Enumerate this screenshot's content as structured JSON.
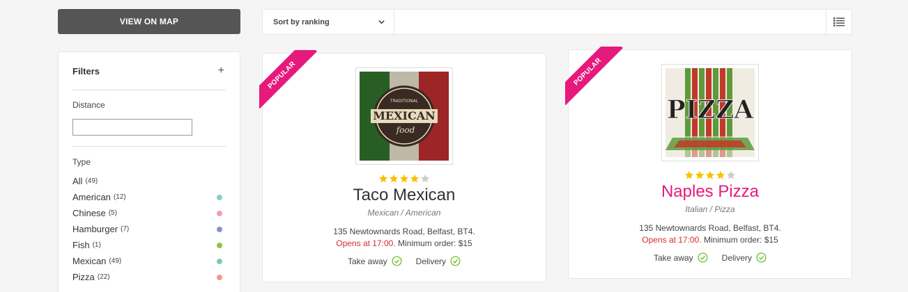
{
  "map_button": {
    "label": "VIEW ON MAP"
  },
  "toolbar": {
    "sort_label": "Sort by ranking",
    "sort_icon": "chevron-down-icon",
    "view_icon": "list-view-icon"
  },
  "filters": {
    "title": "Filters",
    "toggle_symbol": "+",
    "distance_label": "Distance",
    "distance_value": "",
    "type_label": "Type",
    "types": [
      {
        "label": "All",
        "count": "(49)",
        "color": ""
      },
      {
        "label": "American",
        "count": "(12)",
        "color": "#7fd1c9"
      },
      {
        "label": "Chinese",
        "count": "(5)",
        "color": "#f39ac0"
      },
      {
        "label": "Hamburger",
        "count": "(7)",
        "color": "#8a93c6"
      },
      {
        "label": "Fish",
        "count": "(1)",
        "color": "#8cc63f"
      },
      {
        "label": "Mexican",
        "count": "(49)",
        "color": "#7fcba8"
      },
      {
        "label": "Pizza",
        "count": "(22)",
        "color": "#ee9b86"
      }
    ]
  },
  "restaurants": [
    {
      "ribbon": "POPULAR",
      "name": "Taco Mexican",
      "rating": 4,
      "rating_max": 5,
      "cuisine": "Mexican / American",
      "address": "135 Newtownards Road, Belfast, BT4.",
      "opens": "Opens at 17:00.",
      "min_order": "Minimum order: $15",
      "services": [
        "Take away",
        "Delivery"
      ],
      "logo": {
        "top": "TRADITIONAL",
        "main": "MEXICAN",
        "sub": "food"
      }
    },
    {
      "ribbon": "POPULAR",
      "name": "Naples Pizza",
      "rating": 4,
      "rating_max": 5,
      "cuisine": "Italian / Pizza",
      "address": "135 Newtownards Road, Belfast, BT4.",
      "opens": "Opens at 17:00.",
      "min_order": "Minimum order: $15",
      "services": [
        "Take away",
        "Delivery"
      ],
      "logo": {
        "main": "PIZZA"
      }
    }
  ],
  "colors": {
    "accent": "#e6197c",
    "star_on": "#f5c200",
    "star_off": "#cccccc",
    "open_time": "#d12e2e",
    "check": "#6fbf2f",
    "button_dark": "#555555"
  }
}
